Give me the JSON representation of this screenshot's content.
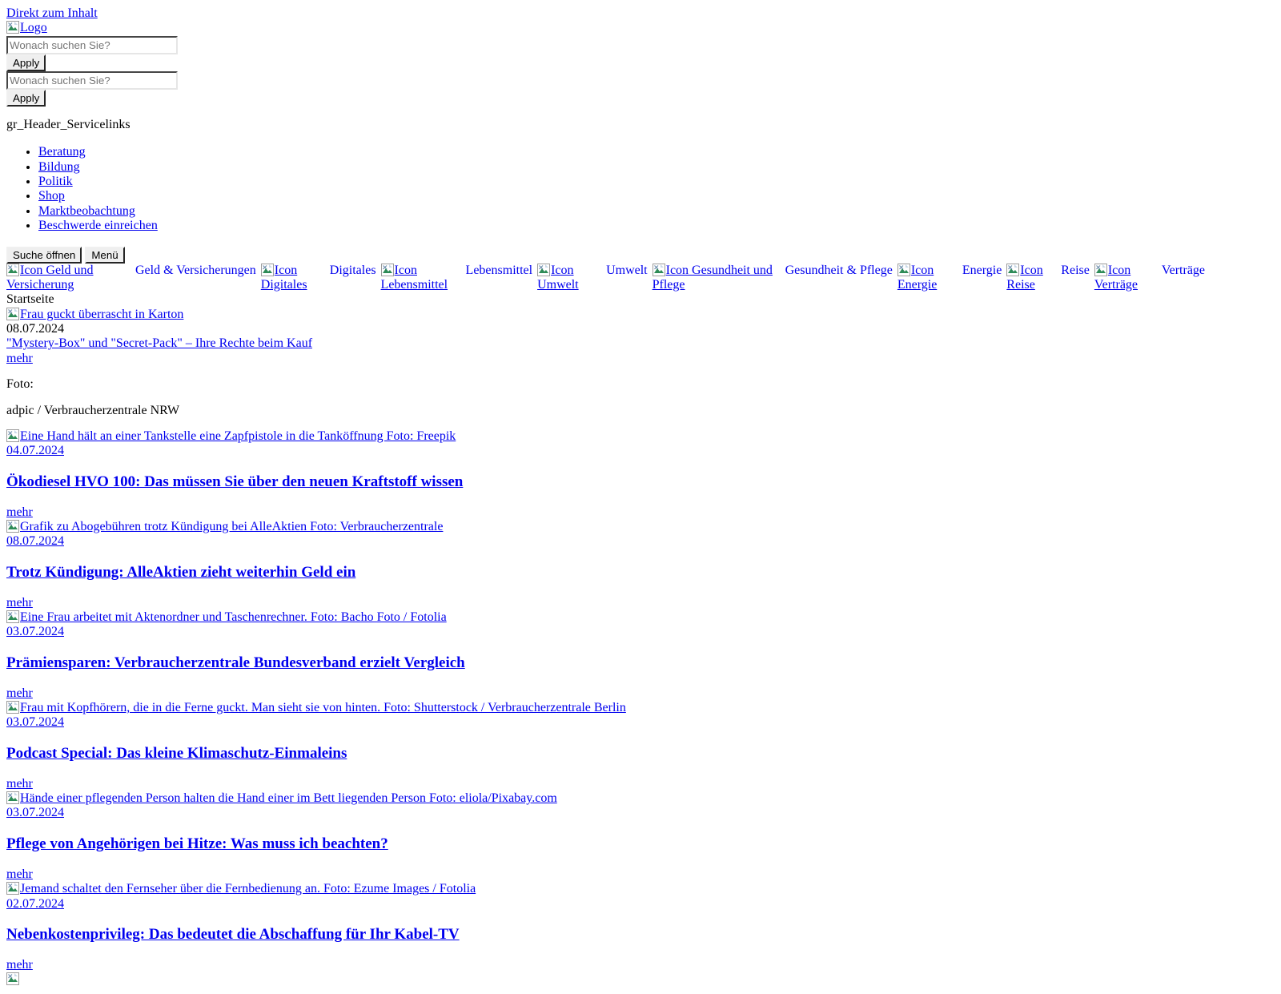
{
  "skip_link": "Direkt zum Inhalt",
  "logo": {
    "alt": "Logo"
  },
  "search": {
    "placeholder": "Wonach suchen Sie?",
    "value": "",
    "submit_label": "Apply"
  },
  "search_secondary": {
    "placeholder": "Wonach suchen Sie?",
    "value": "",
    "submit_label": "Apply"
  },
  "servicelinks": {
    "heading": "gr_Header_Servicelinks",
    "items": [
      {
        "label": "Beratung"
      },
      {
        "label": "Bildung"
      },
      {
        "label": "Politik"
      },
      {
        "label": "Shop"
      },
      {
        "label": "Marktbeobachtung"
      },
      {
        "label": "Beschwerde einreichen"
      }
    ]
  },
  "toolbar": {
    "search_toggle_label": "Suche öffnen",
    "menu_label": "Menü"
  },
  "mainnav": {
    "items": [
      {
        "icon_alt": "Icon Geld und Versicherung",
        "label": "Geld & Versicherungen"
      },
      {
        "icon_alt": "Icon Digitales",
        "label": "Digitales"
      },
      {
        "icon_alt": "Icon Lebensmittel",
        "label": "Lebensmittel"
      },
      {
        "icon_alt": "Icon Umwelt",
        "label": "Umwelt"
      },
      {
        "icon_alt": "Icon Gesundheit und Pflege",
        "label": "Gesundheit & Pflege"
      },
      {
        "icon_alt": "Icon Energie",
        "label": "Energie"
      },
      {
        "icon_alt": "Icon Reise",
        "label": "Reise"
      },
      {
        "icon_alt": "Icon Verträge",
        "label": "Verträge"
      }
    ]
  },
  "breadcrumb": {
    "current": "Startseite"
  },
  "hero": {
    "image_alt": "Frau guckt überrascht in Karton",
    "date": "08.07.2024",
    "title": "\"Mystery-Box\" und \"Secret-Pack\" – Ihre Rechte beim Kauf",
    "more_label": "mehr",
    "photo_label": "Foto:",
    "photo_credit": "adpic / Verbraucherzentrale NRW"
  },
  "teasers": [
    {
      "image_alt": "Eine Hand hält an einer Tankstelle eine Zapfpistole in die Tanköffnung Foto: Freepik",
      "date": "04.07.2024",
      "title": "Ökodiesel HVO 100: Das müssen Sie über den neuen Kraftstoff wissen",
      "more_label": "mehr"
    },
    {
      "image_alt": "Grafik zu Abogebühren trotz Kündigung bei AlleAktien Foto: Verbraucherzentrale",
      "date": "08.07.2024",
      "title": "Trotz Kündigung: AlleAktien zieht weiterhin Geld ein",
      "more_label": "mehr"
    },
    {
      "image_alt": "Eine Frau arbeitet mit Aktenordner und Taschenrechner. Foto: Bacho Foto / Fotolia",
      "date": "03.07.2024",
      "title": "Prämiensparen: Verbraucherzentrale Bundesverband erzielt Vergleich",
      "more_label": "mehr"
    },
    {
      "image_alt": "Frau mit Kopfhörern, die in die Ferne guckt. Man sieht sie von hinten. Foto: Shutterstock / Verbraucherzentrale Berlin",
      "date": "03.07.2024",
      "title": "Podcast Special: Das kleine Klimaschutz-Einmaleins",
      "more_label": "mehr"
    },
    {
      "image_alt": "Hände einer pflegenden Person halten die Hand einer im Bett liegenden Person Foto: eliola/Pixabay.com",
      "date": "03.07.2024",
      "title": "Pflege von Angehörigen bei Hitze: Was muss ich beachten?",
      "more_label": "mehr"
    },
    {
      "image_alt": "Jemand schaltet den Fernseher über die Fernbedienung an. Foto: Ezume Images / Fotolia",
      "date": "02.07.2024",
      "title": "Nebenkostenprivileg: Das bedeutet die Abschaffung für Ihr Kabel-TV",
      "more_label": "mehr"
    }
  ],
  "colors": {
    "link": "#0000ee",
    "text": "#000000",
    "background": "#ffffff"
  }
}
